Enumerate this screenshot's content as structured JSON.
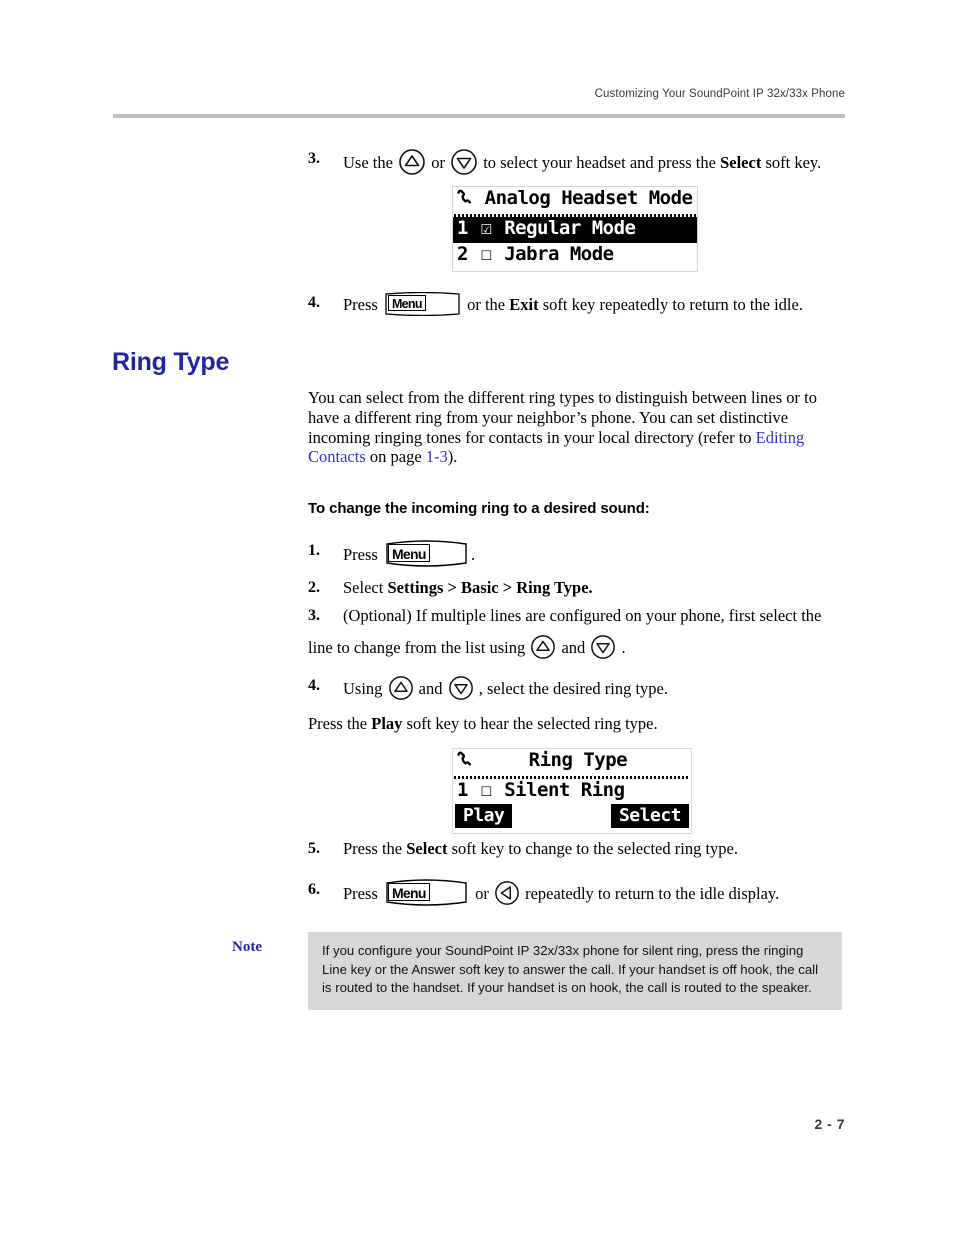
{
  "page": {
    "header_title": "Customizing Your SoundPoint IP 32x/33x Phone",
    "page_number": "2 - 7"
  },
  "top_steps": [
    {
      "num": "3.",
      "text_before": "Use the",
      "icon_1": "up-arrow-key-icon",
      "text_mid": "or",
      "icon_2": "down-arrow-key-icon",
      "text_after_1": "to select your headset and press the",
      "bold_1": "Select",
      "text_after_2": "soft key."
    },
    {
      "num": "4.",
      "text_before": "Press",
      "key_label": "Menu",
      "text_after_1": "or the",
      "bold_1": "Exit",
      "text_after_2": "soft key repeatedly to return to the idle."
    }
  ],
  "lcd_headset": {
    "status_icon": "handset-icon",
    "title": "Analog Headset Mode",
    "rows": [
      {
        "index": "1",
        "checkbox": "checked",
        "label": "Regular Mode",
        "selected": true
      },
      {
        "index": "2",
        "checkbox": "unchecked",
        "label": "Jabra Mode",
        "selected": false
      }
    ]
  },
  "section": {
    "heading": "Ring Type",
    "intro": {
      "part_1": "You can select from the different ring types to distinguish between lines or to have a different ring from your neighbor’s phone. You can set distinctive incoming ringing tones for contacts in your local directory (refer to ",
      "link_1": "Editing Contacts",
      "part_2": " on page ",
      "link_2": "1-3",
      "part_3": ")."
    },
    "subheading": "To change the incoming ring to a desired sound:"
  },
  "ring_steps": [
    {
      "num": "1.",
      "text_before": "Press",
      "key_label": "Menu",
      "text_after": "."
    },
    {
      "num": "2.",
      "text_before": "Select",
      "bold_1": "Settings > Basic > Ring Type."
    },
    {
      "num": "3.",
      "line_1": "(Optional) If multiple lines are configured on your phone, first select the",
      "line_2_before": "line to change from the list using",
      "icon_1": "up-arrow-key-icon",
      "line_2_mid": "and",
      "icon_2": "down-arrow-key-icon",
      "line_2_after": "."
    },
    {
      "num": "4.",
      "line_1_before": "Using",
      "icon_1": "up-arrow-key-icon",
      "line_1_mid": "and",
      "icon_2": "down-arrow-key-icon",
      "line_1_after": ", select the desired ring type.",
      "line_2_before": "Press the",
      "bold_1": "Play",
      "line_2_after": "soft key to hear the selected ring type."
    },
    {
      "num": "5.",
      "text_before": "Press the",
      "bold_1": "Select",
      "text_after": "soft key to change to the selected ring type."
    },
    {
      "num": "6.",
      "text_before": "Press",
      "key_label": "Menu",
      "text_mid": "or",
      "icon_1": "left-arrow-key-icon",
      "text_after": "repeatedly to return to the idle display."
    }
  ],
  "lcd_ringtype": {
    "status_icon": "handset-icon",
    "title": "Ring Type",
    "rows": [
      {
        "index": "1",
        "checkbox": "unchecked",
        "label": "Silent Ring",
        "selected": false
      }
    ],
    "softkeys": [
      {
        "label": "Play"
      },
      {
        "label": "Select"
      }
    ]
  },
  "note": {
    "label": "Note",
    "text": "If you configure your SoundPoint IP 32x/33x phone for silent ring, press the ringing Line key or the Answer soft key to answer the call. If your handset is off hook, the call is routed to the handset. If your handset is on hook, the call is routed to the speaker."
  },
  "colors": {
    "heading_blue": "#2222aa",
    "link_blue": "#3333cc",
    "note_background": "#d7d7d7",
    "rule_gray": "#c0c0c0"
  }
}
